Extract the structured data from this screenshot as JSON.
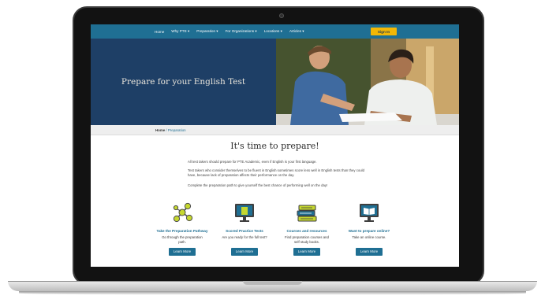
{
  "nav": {
    "items": [
      "Home",
      "Why PTE ▾",
      "Preparation ▾",
      "For Organizations ▾",
      "Locations ▾",
      "Articles ▾"
    ],
    "signin_label": "Sign In"
  },
  "hero": {
    "title": "Prepare for your English Test"
  },
  "breadcrumb": {
    "home": "Home",
    "separator": " / ",
    "current": "Preparation"
  },
  "main": {
    "heading": "It's time to prepare!",
    "paragraphs": [
      "All test takers should prepare for PTE Academic, even if English is your first language.",
      "Test takers who consider themselves to be fluent in English sometimes score less well in English tests than they could have, because lack of preparation affects their performance on the day.",
      "Complete the preparation path to give yourself the best chance of performing well on the day!"
    ]
  },
  "cards": [
    {
      "title": "Take the Preparation Pathway",
      "desc": "Go through the preparation path.",
      "button": "Learn More",
      "icon": "network-icon"
    },
    {
      "title": "Scored Practice Tests",
      "desc": "Are you ready for the full test?",
      "button": "Learn More",
      "icon": "monitor-icon"
    },
    {
      "title": "Courses and resources",
      "desc": "Find preparation courses and self study books.",
      "button": "Learn More",
      "icon": "books-icon"
    },
    {
      "title": "Want to prepare online?",
      "desc": "Take an online course.",
      "button": "Learn More",
      "icon": "online-book-icon"
    }
  ],
  "colors": {
    "nav_bg": "#1f6f93",
    "hero_bg": "#1e3f66",
    "accent_yellow": "#f2b705",
    "icon_green": "#c5d72f",
    "link_blue": "#1f6f93"
  }
}
